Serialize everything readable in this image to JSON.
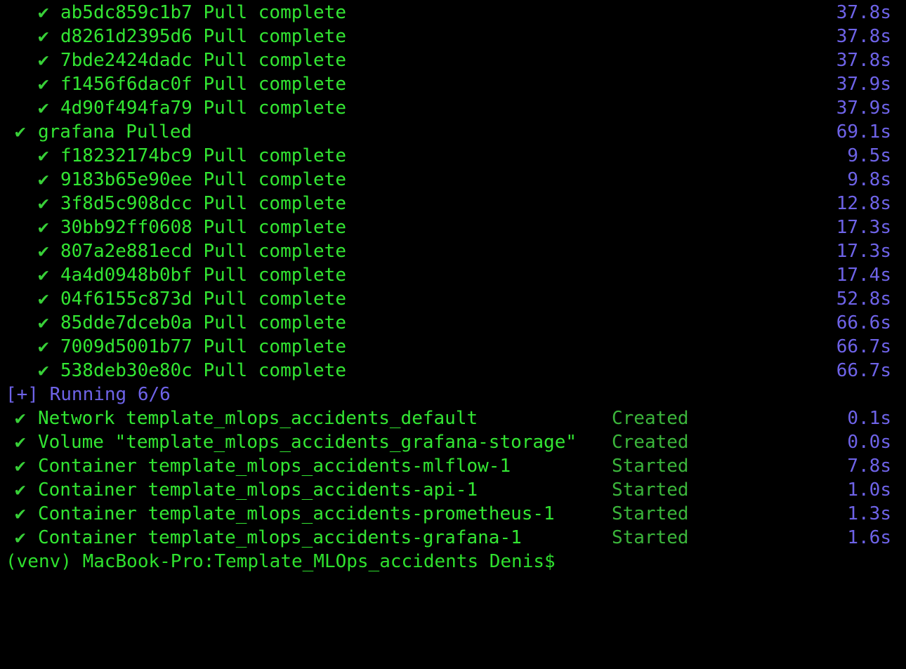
{
  "colors": {
    "background": "#000000",
    "success_green": "#33e633",
    "status_green": "#3bb53b",
    "time_blue": "#6e63e8"
  },
  "terminal": {
    "pull_lines": [
      {
        "kind": "layer",
        "icon": "check-icon",
        "check": "✔",
        "text": "ab5dc859c1b7 Pull complete",
        "time": "37.8s"
      },
      {
        "kind": "layer",
        "icon": "check-icon",
        "check": "✔",
        "text": "d8261d2395d6 Pull complete",
        "time": "37.8s"
      },
      {
        "kind": "layer",
        "icon": "check-icon",
        "check": "✔",
        "text": "7bde2424dadc Pull complete",
        "time": "37.8s"
      },
      {
        "kind": "layer",
        "icon": "check-icon",
        "check": "✔",
        "text": "f1456f6dac0f Pull complete",
        "time": "37.9s"
      },
      {
        "kind": "layer",
        "icon": "check-icon",
        "check": "✔",
        "text": "4d90f494fa79 Pull complete",
        "time": "37.9s"
      },
      {
        "kind": "service",
        "icon": "check-icon",
        "check": "✔",
        "text": "grafana Pulled",
        "time": "69.1s"
      },
      {
        "kind": "layer",
        "icon": "check-icon",
        "check": "✔",
        "text": "f18232174bc9 Pull complete",
        "time": "9.5s"
      },
      {
        "kind": "layer",
        "icon": "check-icon",
        "check": "✔",
        "text": "9183b65e90ee Pull complete",
        "time": "9.8s"
      },
      {
        "kind": "layer",
        "icon": "check-icon",
        "check": "✔",
        "text": "3f8d5c908dcc Pull complete",
        "time": "12.8s"
      },
      {
        "kind": "layer",
        "icon": "check-icon",
        "check": "✔",
        "text": "30bb92ff0608 Pull complete",
        "time": "17.3s"
      },
      {
        "kind": "layer",
        "icon": "check-icon",
        "check": "✔",
        "text": "807a2e881ecd Pull complete",
        "time": "17.3s"
      },
      {
        "kind": "layer",
        "icon": "check-icon",
        "check": "✔",
        "text": "4a4d0948b0bf Pull complete",
        "time": "17.4s"
      },
      {
        "kind": "layer",
        "icon": "check-icon",
        "check": "✔",
        "text": "04f6155c873d Pull complete",
        "time": "52.8s"
      },
      {
        "kind": "layer",
        "icon": "check-icon",
        "check": "✔",
        "text": "85dde7dceb0a Pull complete",
        "time": "66.6s"
      },
      {
        "kind": "layer",
        "icon": "check-icon",
        "check": "✔",
        "text": "7009d5001b77 Pull complete",
        "time": "66.7s"
      },
      {
        "kind": "layer",
        "icon": "check-icon",
        "check": "✔",
        "text": "538deb30e80c Pull complete",
        "time": "66.7s"
      }
    ],
    "running_header": "[+] Running 6/6",
    "resources": [
      {
        "icon": "check-icon",
        "check": "✔",
        "text": "Network template_mlops_accidents_default",
        "status": "Created",
        "time": "0.1s"
      },
      {
        "icon": "check-icon",
        "check": "✔",
        "text": "Volume \"template_mlops_accidents_grafana-storage\"",
        "status": "Created",
        "time": "0.0s"
      },
      {
        "icon": "check-icon",
        "check": "✔",
        "text": "Container template_mlops_accidents-mlflow-1",
        "status": "Started",
        "time": "7.8s"
      },
      {
        "icon": "check-icon",
        "check": "✔",
        "text": "Container template_mlops_accidents-api-1",
        "status": "Started",
        "time": "1.0s"
      },
      {
        "icon": "check-icon",
        "check": "✔",
        "text": "Container template_mlops_accidents-prometheus-1",
        "status": "Started",
        "time": "1.3s"
      },
      {
        "icon": "check-icon",
        "check": "✔",
        "text": "Container template_mlops_accidents-grafana-1",
        "status": "Started",
        "time": "1.6s"
      }
    ],
    "prompt": "(venv) MacBook-Pro:Template_MLOps_accidents Denis$"
  }
}
